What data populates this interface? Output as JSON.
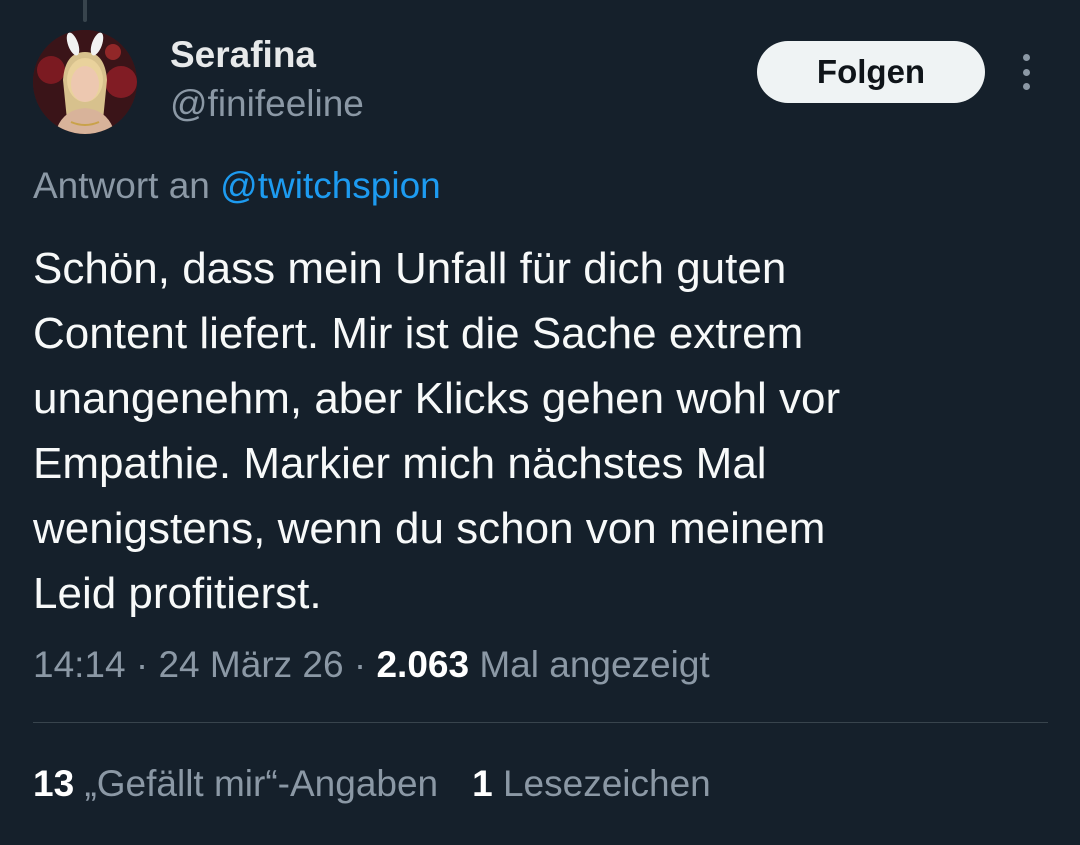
{
  "author": {
    "name": "Serafina",
    "handle": "@finifeeline"
  },
  "follow_button": {
    "label": "Folgen"
  },
  "reply": {
    "prefix": "Antwort an",
    "mention": "@twitchspion"
  },
  "tweet": {
    "lines": [
      "Schön, dass mein Unfall für dich guten",
      "Content liefert. Mir ist die Sache extrem",
      "unangenehm, aber Klicks gehen wohl vor",
      "Empathie. Markier mich nächstes Mal",
      "wenigstens, wenn du schon von meinem",
      "Leid profitierst."
    ]
  },
  "meta": {
    "time": "14:14",
    "separator": "·",
    "date": "24 März 26",
    "views_count": "2.063",
    "views_label": "Mal angezeigt"
  },
  "stats": {
    "likes_count": "13",
    "likes_label": "„Gefällt mir“-Angaben",
    "bookmarks_count": "1",
    "bookmarks_label": "Lesezeichen"
  },
  "colors": {
    "background": "#15202b",
    "accent": "#1d9bf0",
    "secondary_text": "#8b98a5",
    "divider": "#38444d"
  }
}
